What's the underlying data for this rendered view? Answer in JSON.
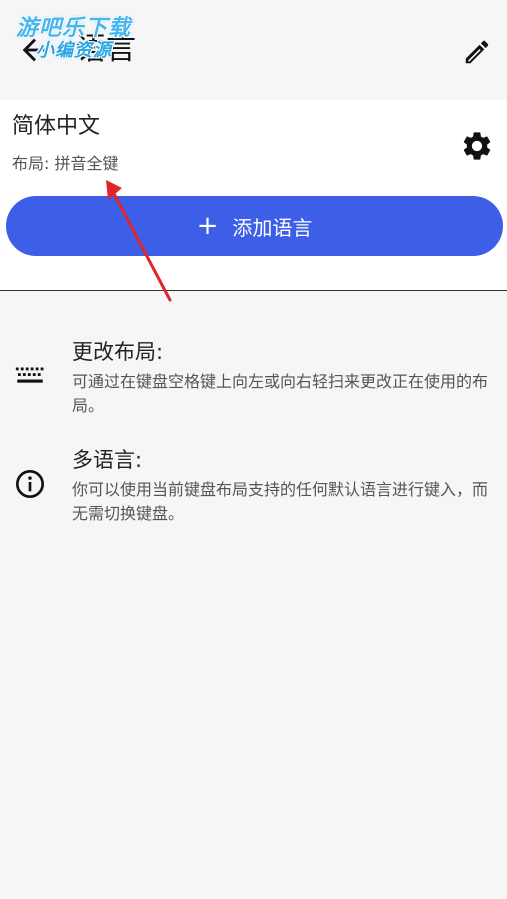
{
  "header": {
    "title": "语言",
    "back_icon": "arrow-left-icon",
    "edit_icon": "pencil-icon"
  },
  "watermark": {
    "line1": "游吧乐下载",
    "line2": "小编资源"
  },
  "language": {
    "name": "简体中文",
    "layout": "布局: 拼音全键",
    "settings_icon": "gear-icon"
  },
  "add_button": {
    "plus": "+",
    "label": "添加语言"
  },
  "tips": [
    {
      "icon": "keyboard-icon",
      "title": "更改布局:",
      "desc": "可通过在键盘空格键上向左或向右轻扫来更改正在使用的布局。"
    },
    {
      "icon": "info-circle-icon",
      "title": "多语言:",
      "desc": "你可以使用当前键盘布局支持的任何默认语言进行键入，而无需切换键盘。"
    }
  ],
  "colors": {
    "accent": "#3d5ee6",
    "background": "#f6f6f6",
    "card": "#ffffff",
    "annotation_arrow": "#e0262b"
  }
}
